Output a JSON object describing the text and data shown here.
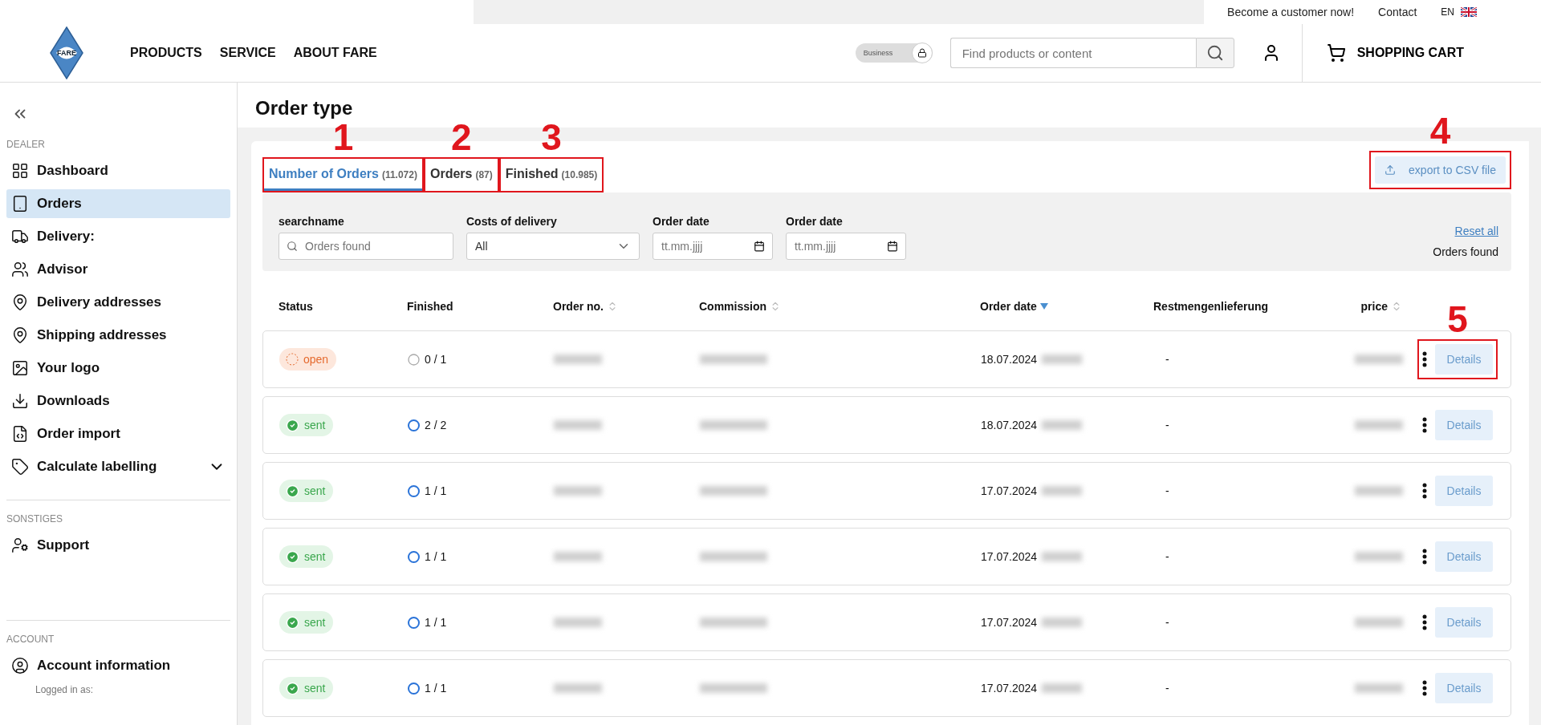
{
  "top_bar": {
    "links": [
      "Become a customer now!",
      "Contact"
    ],
    "language": "EN"
  },
  "header": {
    "logo": "FARE",
    "nav": [
      "PRODUCTS",
      "SERVICE",
      "ABOUT FARE"
    ],
    "toggle": {
      "label": "Business"
    },
    "search": {
      "placeholder": "Find products or content"
    },
    "cart": "SHOPPING CART"
  },
  "sidebar": {
    "sections": [
      {
        "title": "DEALER",
        "items": [
          {
            "label": "Dashboard",
            "selected": false,
            "submenu": false
          },
          {
            "label": "Orders",
            "selected": true,
            "submenu": false
          },
          {
            "label": "Delivery:",
            "selected": false,
            "submenu": false
          },
          {
            "label": "Advisor",
            "selected": false,
            "submenu": false
          },
          {
            "label": "Delivery addresses",
            "selected": false,
            "submenu": false
          },
          {
            "label": "Shipping addresses",
            "selected": false,
            "submenu": false
          },
          {
            "label": "Your logo",
            "selected": false,
            "submenu": false
          },
          {
            "label": "Downloads",
            "selected": false,
            "submenu": false
          },
          {
            "label": "Order import",
            "selected": false,
            "submenu": false
          },
          {
            "label": "Calculate labelling",
            "selected": false,
            "submenu": true
          }
        ]
      },
      {
        "title": "SONSTIGES",
        "items": [
          {
            "label": "Support",
            "selected": false,
            "submenu": false
          }
        ]
      },
      {
        "title": "ACCOUNT",
        "items": [
          {
            "label": "Account information",
            "selected": false,
            "submenu": false
          }
        ],
        "note": "Logged in as:"
      }
    ]
  },
  "page_title": "Order type",
  "tabs": [
    {
      "label": "Number of Orders",
      "count": "(11.072)",
      "selected": true,
      "annotation": "1"
    },
    {
      "label": "Orders",
      "count": "(87)",
      "selected": false,
      "annotation": "2"
    },
    {
      "label": "Finished",
      "count": "(10.985)",
      "selected": false,
      "annotation": "3"
    }
  ],
  "export_button": {
    "label": "export to CSV file",
    "annotation": "4"
  },
  "filters": {
    "search": {
      "label": "searchname",
      "placeholder": "Orders found"
    },
    "costs": {
      "label": "Costs of delivery",
      "value": "All"
    },
    "dates": [
      {
        "label": "Order date",
        "placeholder": "tt.mm.jjjj"
      },
      {
        "label": "Order date",
        "placeholder": "tt.mm.jjjj"
      }
    ],
    "reset": "Reset all",
    "found": "Orders found"
  },
  "table": {
    "columns": [
      {
        "label": "Status",
        "kind": "plain"
      },
      {
        "label": "Finished",
        "kind": "plain"
      },
      {
        "label": "Order no.",
        "kind": "sortable"
      },
      {
        "label": "Commission",
        "kind": "sortable"
      },
      {
        "label": "Order date",
        "kind": "sorted"
      },
      {
        "label": "Restmengenlieferung",
        "kind": "plain"
      },
      {
        "label": "price",
        "kind": "sortable"
      }
    ],
    "rows": [
      {
        "status": "open",
        "kind": "open",
        "finished": "0 / 1",
        "complete": false,
        "date": "18.07.2024",
        "rest": "-",
        "details": "Details",
        "annotation": "5"
      },
      {
        "status": "sent",
        "kind": "sent",
        "finished": "2 / 2",
        "complete": true,
        "date": "18.07.2024",
        "rest": "-",
        "details": "Details"
      },
      {
        "status": "sent",
        "kind": "sent",
        "finished": "1 / 1",
        "complete": true,
        "date": "17.07.2024",
        "rest": "-",
        "details": "Details"
      },
      {
        "status": "sent",
        "kind": "sent",
        "finished": "1 / 1",
        "complete": true,
        "date": "17.07.2024",
        "rest": "-",
        "details": "Details"
      },
      {
        "status": "sent",
        "kind": "sent",
        "finished": "1 / 1",
        "complete": true,
        "date": "17.07.2024",
        "rest": "-",
        "details": "Details"
      },
      {
        "status": "sent",
        "kind": "sent",
        "finished": "1 / 1",
        "complete": true,
        "date": "17.07.2024",
        "rest": "-",
        "details": "Details"
      }
    ]
  }
}
